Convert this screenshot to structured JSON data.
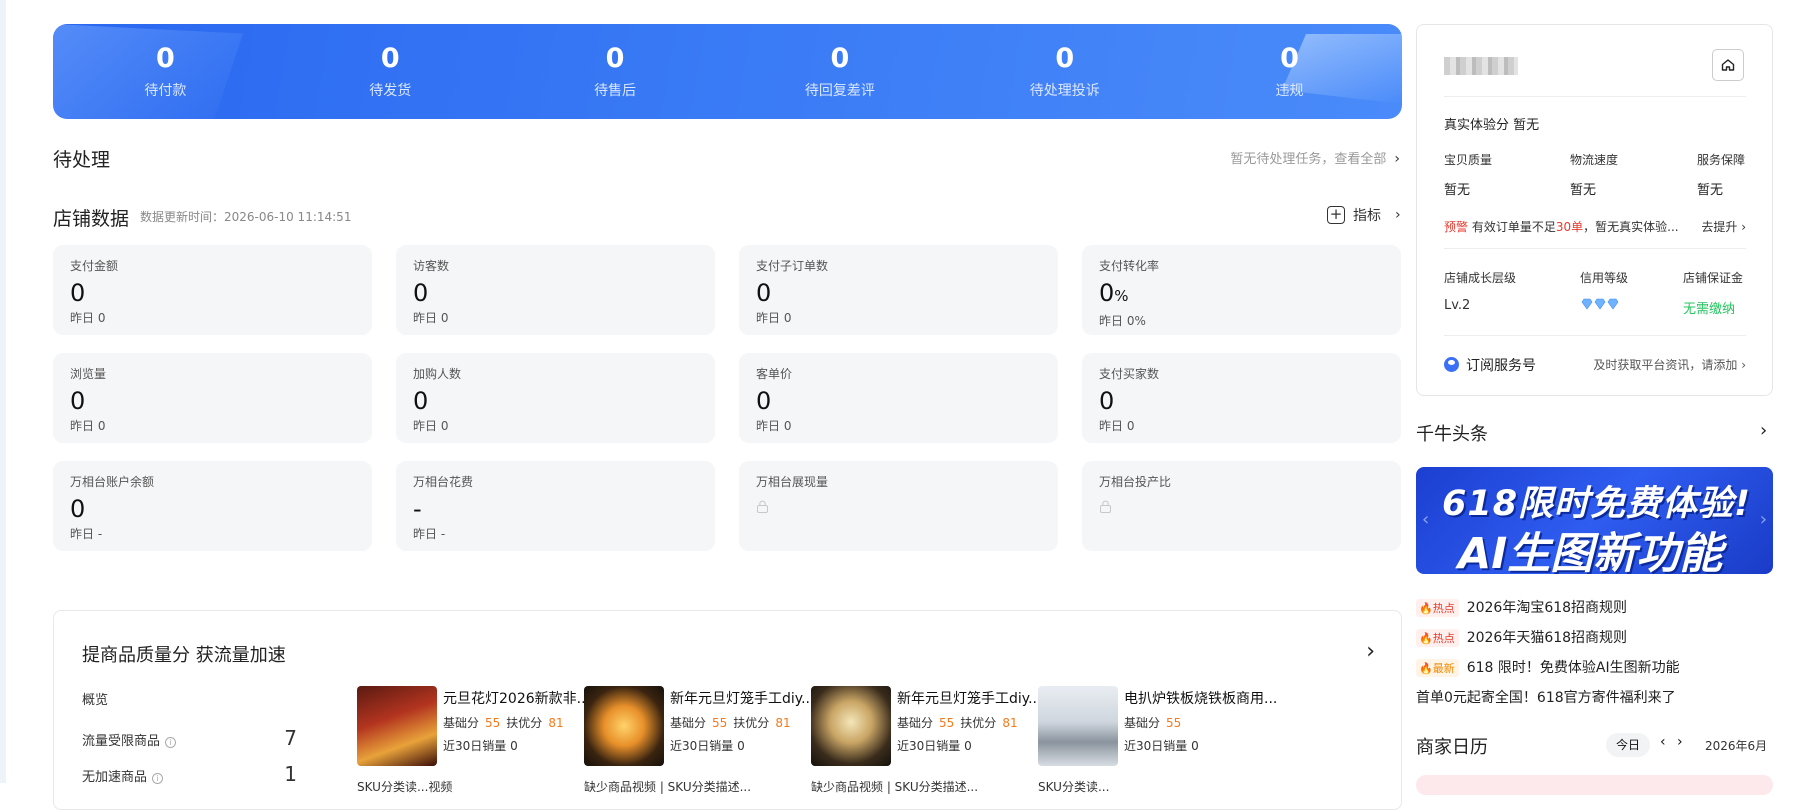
{
  "banner": {
    "stats": [
      {
        "value": "0",
        "label": "待付款"
      },
      {
        "value": "0",
        "label": "待发货"
      },
      {
        "value": "0",
        "label": "待售后"
      },
      {
        "value": "0",
        "label": "待回复差评"
      },
      {
        "value": "0",
        "label": "待处理投诉"
      },
      {
        "value": "0",
        "label": "违规"
      }
    ]
  },
  "pending": {
    "title": "待处理",
    "link": "暂无待处理任务，查看全部"
  },
  "store": {
    "title": "店铺数据",
    "update_time": "数据更新时间：2026-06-10 11:14:51",
    "indicator_label": "指标",
    "cards": [
      {
        "title": "支付金额",
        "value": "0",
        "yesterday": "昨日 0"
      },
      {
        "title": "访客数",
        "value": "0",
        "yesterday": "昨日 0"
      },
      {
        "title": "支付子订单数",
        "value": "0",
        "yesterday": "昨日 0"
      },
      {
        "title": "支付转化率",
        "value": "0",
        "unit": "%",
        "yesterday": "昨日 0%"
      },
      {
        "title": "浏览量",
        "value": "0",
        "yesterday": "昨日 0"
      },
      {
        "title": "加购人数",
        "value": "0",
        "yesterday": "昨日 0"
      },
      {
        "title": "客单价",
        "value": "0",
        "yesterday": "昨日 0"
      },
      {
        "title": "支付买家数",
        "value": "0",
        "yesterday": "昨日 0"
      },
      {
        "title": "万相台账户余额",
        "value": "0",
        "yesterday": "昨日 -"
      },
      {
        "title": "万相台花费",
        "value": "-",
        "yesterday": "昨日 -"
      },
      {
        "title": "万相台展现量",
        "locked": true
      },
      {
        "title": "万相台投产比",
        "locked": true
      }
    ]
  },
  "quality": {
    "title": "提商品质量分 获流量加速",
    "overview_label": "概览",
    "overview": [
      {
        "label": "流量受限商品",
        "value": "7"
      },
      {
        "label": "无加速商品",
        "value": "1"
      }
    ],
    "products": [
      {
        "name": "元旦花灯2026新款非...",
        "base_label": "基础分",
        "base": "55",
        "opt_label": "扶优分",
        "opt": "81",
        "sales": "近30日销量 0",
        "sub": "SKU分类读...视频"
      },
      {
        "name": "新年元旦灯笼手工diy...",
        "base_label": "基础分",
        "base": "55",
        "opt_label": "扶优分",
        "opt": "81",
        "sales": "近30日销量 0",
        "sub": "缺少商品视频 | SKU分类描述..."
      },
      {
        "name": "新年元旦灯笼手工diy...",
        "base_label": "基础分",
        "base": "55",
        "opt_label": "扶优分",
        "opt": "81",
        "sales": "近30日销量 0",
        "sub": "缺少商品视频 | SKU分类描述..."
      },
      {
        "name": "电扒炉铁板烧铁板商用...",
        "base_label": "基础分",
        "base": "55",
        "sales": "近30日销量 0",
        "sub": "SKU分类读..."
      }
    ]
  },
  "shop_panel": {
    "experience": "真实体验分  暂无",
    "metrics": [
      {
        "label": "宝贝质量",
        "value": "暂无"
      },
      {
        "label": "物流速度",
        "value": "暂无"
      },
      {
        "label": "服务保障",
        "value": "暂无"
      }
    ],
    "warning_tag": "预警",
    "warning_pre": " 有效订单量不足",
    "warning_num": "30单",
    "warning_post": "，暂无真实体验...",
    "improve": "去提升",
    "levels": [
      {
        "label": "店铺成长层级",
        "value": "Lv.2"
      },
      {
        "label": "信用等级",
        "value": ""
      },
      {
        "label": "店铺保证金",
        "value": "无需缴纳"
      }
    ],
    "subscribe_label": "订阅服务号",
    "subscribe_hint": "及时获取平台资讯，请添加"
  },
  "qianniu": {
    "title": "千牛头条",
    "ad_line1": "618限时免费体验!",
    "ad_line2": "AI生图新功能",
    "news": [
      {
        "tag": "热点",
        "text": "2026年淘宝618招商规则"
      },
      {
        "tag": "热点",
        "text": "2026年天猫618招商规则"
      },
      {
        "tag": "最新",
        "text": "618 限时！免费体验AI生图新功能"
      },
      {
        "tag": "",
        "text": "首单0元起寄全国！618官方寄件福利来了"
      }
    ]
  },
  "calendar": {
    "title": "商家日历",
    "today": "今日",
    "month": "2026年6月"
  },
  "colors": {
    "accent": "#3b7cf6",
    "warn": "#e63b2e",
    "score": "#f37b1d",
    "green": "#22c55e"
  }
}
